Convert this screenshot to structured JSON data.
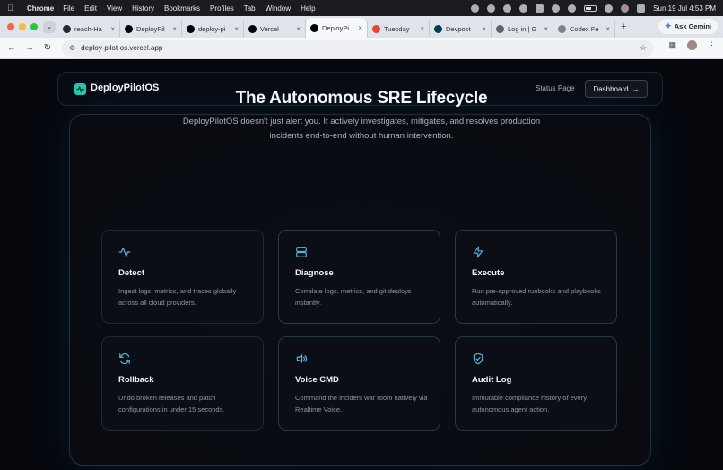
{
  "menubar": {
    "app": "Chrome",
    "items": [
      "File",
      "Edit",
      "View",
      "History",
      "Bookmarks",
      "Profiles",
      "Tab",
      "Window",
      "Help"
    ],
    "clock": "Sun 19 Jul  4:53 PM"
  },
  "tabs": [
    {
      "label": "reach-Ha",
      "favicon": "github-icon",
      "color": "#24292f"
    },
    {
      "label": "DeployPil",
      "favicon": "vercel-icon",
      "color": "#000000"
    },
    {
      "label": "deploy-pi",
      "favicon": "vercel-icon",
      "color": "#000000"
    },
    {
      "label": "Vercel",
      "favicon": "vercel-icon",
      "color": "#000000"
    },
    {
      "label": "DeployPi",
      "favicon": "vercel-icon",
      "color": "#000000",
      "active": true
    },
    {
      "label": "Tuesday",
      "favicon": "gmail-icon",
      "color": "#ea4335"
    },
    {
      "label": "Devpost",
      "favicon": "devpost-icon",
      "color": "#003e54"
    },
    {
      "label": "Log in | G",
      "favicon": "login-icon",
      "color": "#5a6270"
    },
    {
      "label": "Codex Fe",
      "favicon": "codex-icon",
      "color": "#7b8190"
    }
  ],
  "ask_gemini": "Ask Gemini",
  "address": {
    "url": "deploy-pilot-os.vercel.app"
  },
  "site": {
    "brand": "DeployPilotOS",
    "nav_status": "Status Page",
    "nav_dashboard": "Dashboard",
    "dashboard_arrow": "→",
    "heading": "The Autonomous SRE Lifecycle",
    "subtitle": "DeployPilotOS doesn't just alert you. It actively investigates, mitigates, and resolves production incidents end-to-end without human intervention.",
    "accent": "#5ab4e0",
    "cards": [
      {
        "title": "Detect",
        "desc": "Ingest logs, metrics, and traces globally across all cloud providers.",
        "icon": "activity-icon"
      },
      {
        "title": "Diagnose",
        "desc": "Correlate logs, metrics, and git deploys instantly.",
        "icon": "server-icon"
      },
      {
        "title": "Execute",
        "desc": "Run pre-approved runbooks and playbooks automatically.",
        "icon": "bolt-icon"
      },
      {
        "title": "Rollback",
        "desc": "Undo broken releases and patch configurations in under 15 seconds.",
        "icon": "refresh-icon"
      },
      {
        "title": "Voice CMD",
        "desc": "Command the incident war room natively via Realtime Voice.",
        "icon": "speaker-icon"
      },
      {
        "title": "Audit Log",
        "desc": "Immutable compliance history of every autonomous agent action.",
        "icon": "shield-check-icon"
      }
    ]
  }
}
